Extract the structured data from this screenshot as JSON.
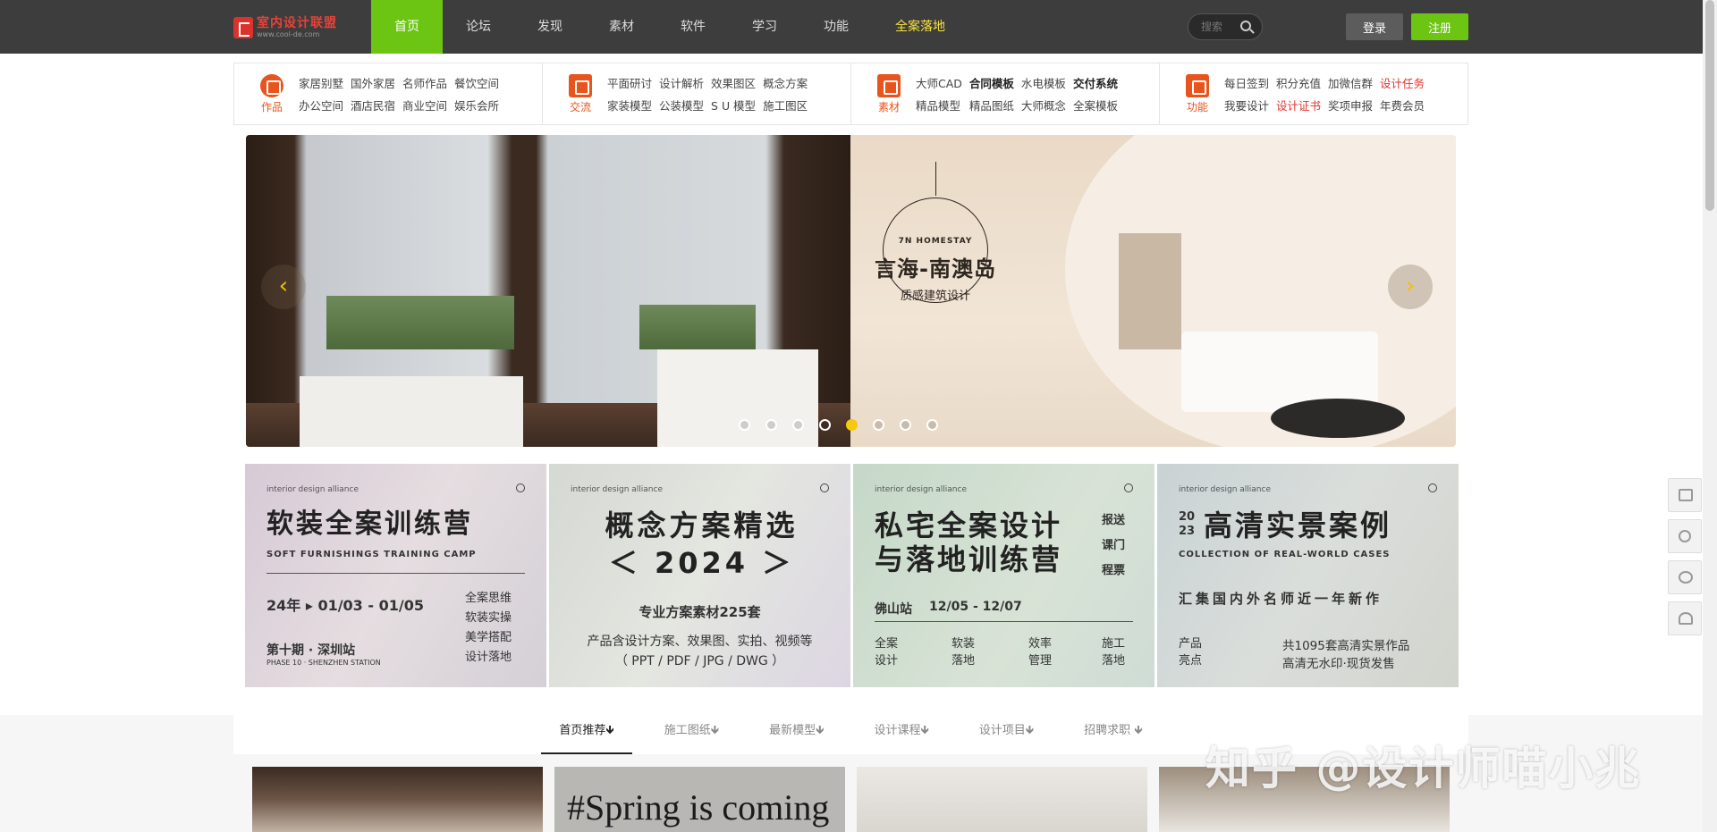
{
  "header": {
    "logo_main": "室内设计联盟",
    "logo_sub": "www.cool-de.com",
    "nav": [
      "首页",
      "论坛",
      "发现",
      "素材",
      "软件",
      "学习",
      "功能",
      "全案落地"
    ],
    "search_placeholder": "搜索",
    "login_label": "登录",
    "register_label": "注册",
    "accent": "#6cc413"
  },
  "categories": [
    {
      "label": "作品",
      "links": [
        "家居别墅",
        "国外家居",
        "名师作品",
        "餐饮空间",
        "办公空间",
        "酒店民宿",
        "商业空间",
        "娱乐会所"
      ]
    },
    {
      "label": "交流",
      "links": [
        "平面研讨",
        "设计解析",
        "效果图区",
        "概念方案",
        "家装模型",
        "公装模型",
        "S U 模型",
        "施工图区"
      ]
    },
    {
      "label": "素材",
      "links": [
        "大师CAD",
        "合同模板",
        "水电模板",
        "交付系统",
        "精品模型",
        "精品图纸",
        "大师概念",
        "全案模板"
      ]
    },
    {
      "label": "功能",
      "links": [
        "每日签到",
        "积分充值",
        "加微信群",
        "设计任务",
        "我要设计",
        "设计证书",
        "奖项申报",
        "年费会员"
      ]
    }
  ],
  "banner": {
    "brand_en": "7N HOMESTAY",
    "brand_title": "言海-南澳岛",
    "brand_sub": "质感建筑设计",
    "prev": "‹",
    "next": "›",
    "slide_count": 8,
    "active_slide": 5
  },
  "promos": [
    {
      "tag": "interior design alliance",
      "title": "软装全案训练营",
      "en": "SOFT FURNISHINGS TRAINING CAMP",
      "date": "24年 ▸ 01/03 - 01/05",
      "notes": [
        "全案思维",
        "软装实操",
        "美学搭配",
        "设计落地"
      ],
      "station": "第十期 · 深圳站",
      "station_en": "PHASE 10 · SHENZHEN STATION"
    },
    {
      "tag": "interior design alliance",
      "title": "概念方案精选",
      "year": "＜ 2024 ＞",
      "sub": "专业方案素材225套",
      "desc1": "产品含设计方案、效果图、实拍、视频等",
      "desc2": "（ PPT / PDF / JPG / DWG ）"
    },
    {
      "tag": "interior design alliance",
      "title1": "私宅全案设计",
      "title2": "与落地训练营",
      "side": [
        "报送",
        "课门",
        "程票"
      ],
      "station": "佛山站",
      "dates": "12/05 - 12/07",
      "items": [
        "全案设计",
        "软装落地",
        "效率管理",
        "施工落地"
      ]
    },
    {
      "tag": "interior design alliance",
      "title": "高清实景案例",
      "year_mark": "20 23",
      "en": "COLLECTION OF REAL-WORLD CASES",
      "slogan": "汇集国内外名师近一年新作",
      "label1": "产品亮点",
      "line1": "共1095套高清实景作品",
      "line2": "高清无水印·现货发售"
    }
  ],
  "tabs": [
    "首页推荐🡻",
    "施工图纸🡻",
    "最新模型🡻",
    "设计课程🡻",
    "设计项目🡻",
    "招聘求职 🡻"
  ],
  "cards": [
    {
      "text": ""
    },
    {
      "text": "#Spring is coming"
    },
    {
      "text": ""
    },
    {
      "text": ""
    }
  ],
  "watermark": "知乎 @设计师喵小兆",
  "sidebar": [
    "calendar-icon",
    "search-icon",
    "wechat-icon",
    "user-icon"
  ]
}
